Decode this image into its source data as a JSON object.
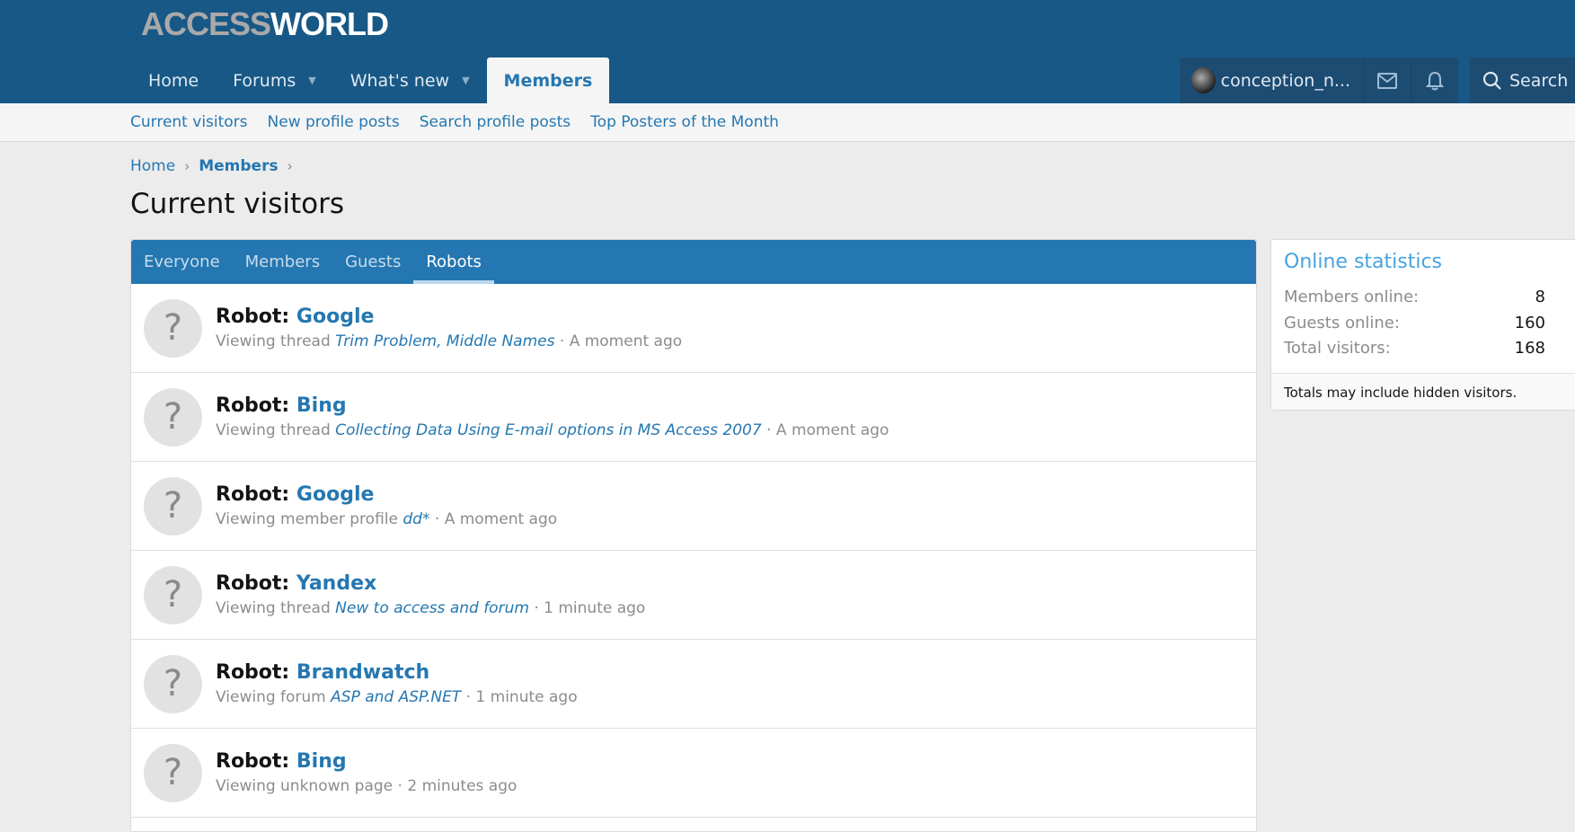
{
  "logo": {
    "part1": "ACCESS",
    "part2": "WORLD"
  },
  "nav": {
    "items": [
      {
        "label": "Home"
      },
      {
        "label": "Forums"
      },
      {
        "label": "What's new"
      },
      {
        "label": "Members"
      }
    ],
    "user": "conception_n...",
    "search": "Search"
  },
  "subnav": [
    "Current visitors",
    "New profile posts",
    "Search profile posts",
    "Top Posters of the Month"
  ],
  "breadcrumb": [
    "Home",
    "Members"
  ],
  "page_title": "Current visitors",
  "tabs": [
    "Everyone",
    "Members",
    "Guests",
    "Robots"
  ],
  "rows": [
    {
      "label": "Robot:",
      "bot": "Google",
      "action": "Viewing thread",
      "target": "Trim Problem, Middle Names",
      "time": "A moment ago"
    },
    {
      "label": "Robot:",
      "bot": "Bing",
      "action": "Viewing thread",
      "target": "Collecting Data Using E-mail options in MS Access 2007",
      "time": "A moment ago"
    },
    {
      "label": "Robot:",
      "bot": "Google",
      "action": "Viewing member profile",
      "target": "dd*",
      "time": "A moment ago"
    },
    {
      "label": "Robot:",
      "bot": "Yandex",
      "action": "Viewing thread",
      "target": "New to access and forum",
      "time": "1 minute ago"
    },
    {
      "label": "Robot:",
      "bot": "Brandwatch",
      "action": "Viewing forum",
      "target": "ASP and ASP.NET",
      "time": "1 minute ago"
    },
    {
      "label": "Robot:",
      "bot": "Bing",
      "action": "Viewing unknown page",
      "target": "",
      "time": "2 minutes ago"
    }
  ],
  "sidebar": {
    "title": "Online statistics",
    "stats": [
      {
        "k": "Members online:",
        "v": "8"
      },
      {
        "k": "Guests online:",
        "v": "160"
      },
      {
        "k": "Total visitors:",
        "v": "168"
      }
    ],
    "note": "Totals may include hidden visitors."
  }
}
